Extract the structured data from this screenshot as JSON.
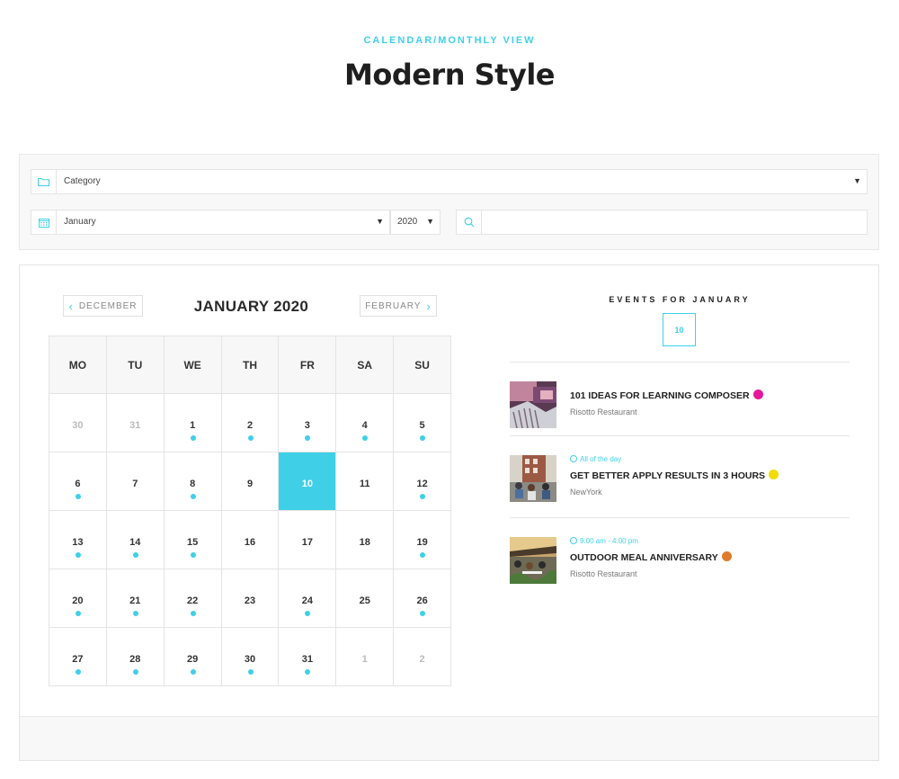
{
  "header": {
    "eyebrow": "CALENDAR/MONTHLY VIEW",
    "title": "Modern Style"
  },
  "filters": {
    "category": {
      "value": "Category",
      "icon": "folder-icon"
    },
    "month": {
      "value": "January",
      "icon": "calendar-icon"
    },
    "year": {
      "value": "2020"
    },
    "search": {
      "value": "",
      "icon": "search-icon"
    }
  },
  "calendar": {
    "prev_label": "DECEMBER",
    "next_label": "FEBRUARY",
    "title": "JANUARY 2020",
    "weekdays": [
      "MO",
      "TU",
      "WE",
      "TH",
      "FR",
      "SA",
      "SU"
    ],
    "weeks": [
      [
        {
          "d": "30",
          "muted": true
        },
        {
          "d": "31",
          "muted": true
        },
        {
          "d": "1",
          "dot": true
        },
        {
          "d": "2",
          "dot": true
        },
        {
          "d": "3",
          "dot": true
        },
        {
          "d": "4",
          "dot": true
        },
        {
          "d": "5",
          "dot": true
        }
      ],
      [
        {
          "d": "6",
          "dot": true
        },
        {
          "d": "7"
        },
        {
          "d": "8",
          "dot": true
        },
        {
          "d": "9"
        },
        {
          "d": "10",
          "today": true
        },
        {
          "d": "11"
        },
        {
          "d": "12",
          "dot": true
        }
      ],
      [
        {
          "d": "13",
          "dot": true
        },
        {
          "d": "14",
          "dot": true
        },
        {
          "d": "15",
          "dot": true
        },
        {
          "d": "16"
        },
        {
          "d": "17"
        },
        {
          "d": "18"
        },
        {
          "d": "19",
          "dot": true
        }
      ],
      [
        {
          "d": "20",
          "dot": true
        },
        {
          "d": "21",
          "dot": true
        },
        {
          "d": "22",
          "dot": true
        },
        {
          "d": "23"
        },
        {
          "d": "24",
          "dot": true
        },
        {
          "d": "25"
        },
        {
          "d": "26",
          "dot": true
        }
      ],
      [
        {
          "d": "27",
          "dot": true
        },
        {
          "d": "28",
          "dot": true
        },
        {
          "d": "29",
          "dot": true
        },
        {
          "d": "30",
          "dot": true
        },
        {
          "d": "31",
          "dot": true
        },
        {
          "d": "1",
          "muted": true
        },
        {
          "d": "2",
          "muted": true
        }
      ]
    ],
    "accent": "#3fd0e8"
  },
  "events": {
    "title": "EVENTS FOR JANUARY",
    "selected_day": "10",
    "items": [
      {
        "time": "",
        "name": "101 IDEAS FOR LEARNING COMPOSER",
        "color": "#e5179a",
        "location": "Risotto Restaurant",
        "thumb": "fabric"
      },
      {
        "time": "All of the day",
        "name": "GET BETTER APPLY RESULTS IN 3 HOURS",
        "color": "#f2dc00",
        "location": "NewYork",
        "thumb": "building"
      },
      {
        "time": "9:00 am - 4:00 pm",
        "name": "OUTDOOR MEAL ANNIVERSARY",
        "color": "#e07b2b",
        "location": "Risotto Restaurant",
        "thumb": "terrace"
      }
    ]
  }
}
